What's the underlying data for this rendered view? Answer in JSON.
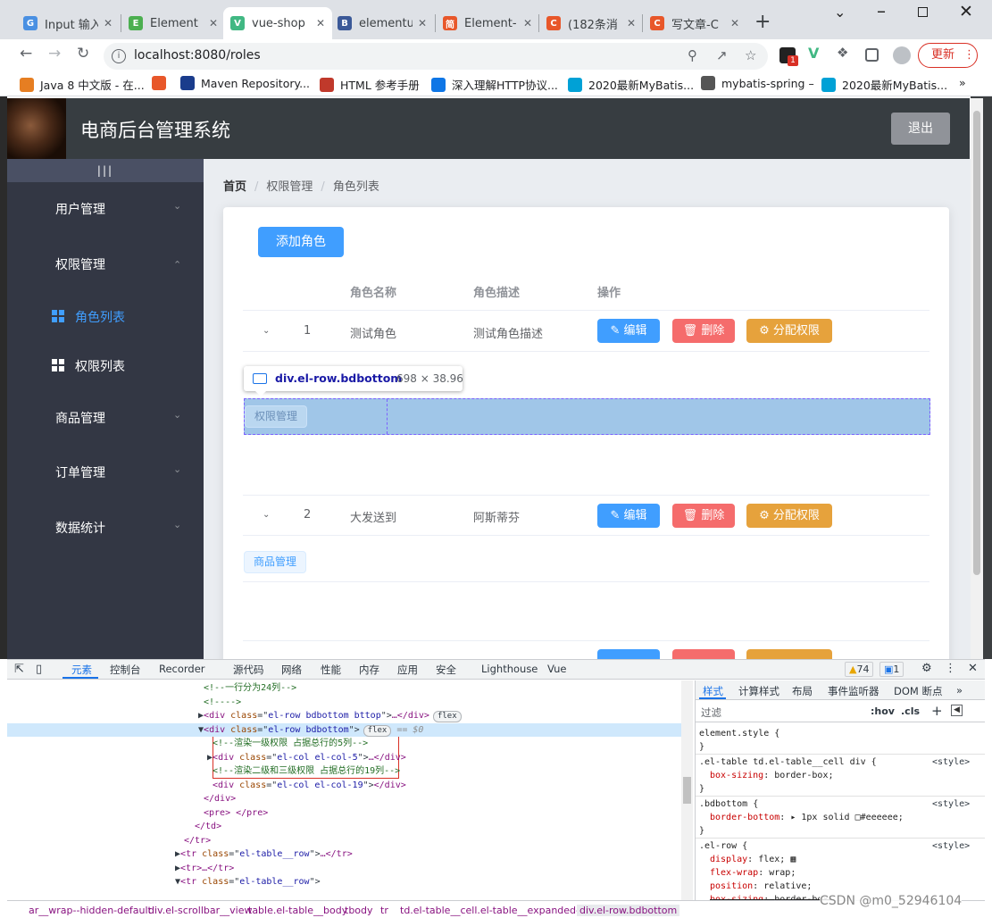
{
  "browser": {
    "tabs": [
      {
        "title": "Input 输入",
        "icon_color": "#4a90e2",
        "icon_char": "G"
      },
      {
        "title": "Element",
        "icon_color": "#4caf50",
        "icon_char": "E"
      },
      {
        "title": "vue-shop",
        "icon_color": "#41b883",
        "icon_char": "V"
      },
      {
        "title": "elementui",
        "icon_color": "#3b5998",
        "icon_char": "B"
      },
      {
        "title": "Element-",
        "icon_color": "#e8572a",
        "icon_char": "简"
      },
      {
        "title": "(182条消",
        "icon_color": "#e8572a",
        "icon_char": "C"
      },
      {
        "title": "写文章-C",
        "icon_color": "#e8572a",
        "icon_char": "C"
      }
    ],
    "url": "localhost:8080/roles",
    "update_label": "更新",
    "ext_badge": "1",
    "bookmarks": [
      {
        "label": "Java 8 中文版 - 在...",
        "color": "#e67e22"
      },
      {
        "label": "",
        "color": "#e8572a"
      },
      {
        "label": "Maven Repository...",
        "color": "#1a3c8c"
      },
      {
        "label": "HTML 参考手册",
        "color": "#c0392b"
      },
      {
        "label": "深入理解HTTP协议...",
        "color": "#0e76e6"
      },
      {
        "label": "2020最新MyBatis...",
        "color": "#00a1d6"
      },
      {
        "label": "mybatis-spring –",
        "color": "#555555"
      },
      {
        "label": "2020最新MyBatis...",
        "color": "#00a1d6"
      }
    ]
  },
  "app": {
    "title": "电商后台管理系统",
    "logout_label": "退出",
    "toggle_label": "|||",
    "menu": [
      {
        "label": "用户管理",
        "open": false
      },
      {
        "label": "权限管理",
        "open": true
      },
      {
        "label": "商品管理",
        "open": false
      },
      {
        "label": "订单管理",
        "open": false
      },
      {
        "label": "数据统计",
        "open": false
      }
    ],
    "submenu": [
      {
        "label": "角色列表",
        "active": true
      },
      {
        "label": "权限列表",
        "active": false
      }
    ],
    "breadcrumb": [
      "首页",
      "权限管理",
      "角色列表"
    ],
    "add_role_label": "添加角色",
    "table": {
      "headers": [
        "角色名称",
        "角色描述",
        "操作"
      ],
      "rows": [
        {
          "index": "1",
          "name": "测试角色",
          "desc": "测试角色描述"
        },
        {
          "index": "2",
          "name": "大发送到",
          "desc": "阿斯蒂芬"
        }
      ],
      "actions": {
        "edit": "编辑",
        "delete": "删除",
        "assign": "分配权限"
      },
      "tags": [
        "权限管理",
        "商品管理"
      ]
    },
    "inspect_tooltip": {
      "tag": "div",
      "class": ".el-row.bdbottom",
      "size": "698 × 38.96"
    }
  },
  "devtools": {
    "tabs": [
      "元素",
      "控制台",
      "Recorder",
      "源代码",
      "网络",
      "性能",
      "内存",
      "应用",
      "安全",
      "Lighthouse",
      "Vue"
    ],
    "warnings": "74",
    "messages": "1",
    "elements": [
      {
        "indent": 228,
        "text": "<!--一行分为24列-->",
        "type": "comment"
      },
      {
        "indent": 228,
        "text": "<!---->",
        "type": "comment"
      },
      {
        "indent": 222,
        "arrow": "▶",
        "tag": "div",
        "cls": "el-row bdbottom bttop",
        "tail": "…</div>",
        "flex": true
      },
      {
        "indent": 222,
        "arrow": "▼",
        "tag": "div",
        "cls": "el-row bdbottom",
        "tail": "",
        "flex": true,
        "selected": true
      },
      {
        "indent": 238,
        "text": "<!--渲染一级权限 占据总行的5列-->",
        "type": "comment"
      },
      {
        "indent": 232,
        "arrow": "▶",
        "tag": "div",
        "cls": "el-col el-col-5",
        "tail": "…</div>"
      },
      {
        "indent": 238,
        "text": "<!--渲染二级和三级权限 占据总行的19列-->",
        "type": "comment"
      },
      {
        "indent": 238,
        "tag": "div",
        "cls": "el-col el-col-19",
        "tail": "</div>"
      },
      {
        "indent": 228,
        "text": "</div>",
        "type": "close"
      },
      {
        "indent": 228,
        "text": "<pre> </pre>",
        "type": "close"
      },
      {
        "indent": 218,
        "text": "</td>",
        "type": "close"
      },
      {
        "indent": 206,
        "text": "</tr>",
        "type": "close"
      },
      {
        "indent": 196,
        "arrow": "▶",
        "tag": "tr",
        "cls": "el-table__row",
        "tail": "…</tr>"
      },
      {
        "indent": 196,
        "arrow": "▶",
        "text": "<tr>…</tr>",
        "type": "close"
      },
      {
        "indent": 196,
        "arrow": "▼",
        "tag": "tr",
        "cls": "el-table__row",
        "tail": ""
      }
    ],
    "selected_suffix": "== $0",
    "flex_label": "flex",
    "style_tabs": [
      "样式",
      "计算样式",
      "布局",
      "事件监听器",
      "DOM 断点"
    ],
    "filter_placeholder": "过滤",
    "hov_label": ":hov",
    "cls_label": ".cls",
    "rules": [
      {
        "sel": "element.style {",
        "props": [],
        "src": ""
      },
      {
        "sel": ".el-table td.el-table__cell div {",
        "props": [
          [
            "box-sizing",
            "border-box;"
          ]
        ],
        "src": "<style>"
      },
      {
        "sel": ".bdbottom {",
        "props": [
          [
            "border-bottom",
            "▸ 1px solid □#eeeeee;"
          ]
        ],
        "src": "<style>"
      },
      {
        "sel": ".el-row {",
        "props": [
          [
            "display",
            "flex; ▦"
          ],
          [
            "flex-wrap",
            "wrap;"
          ],
          [
            "position",
            "relative;"
          ],
          [
            "box-sizing",
            "border-box;"
          ]
        ],
        "src": "<style>"
      }
    ],
    "breadcrumbs": [
      "ar__wrap--hidden-default",
      "div.el-scrollbar__view",
      "table.el-table__body",
      "tbody",
      "tr",
      "td.el-table__cell.el-table__expanded-cell",
      "div.el-row.bdbottom"
    ]
  },
  "watermark": "CSDN @m0_52946104"
}
